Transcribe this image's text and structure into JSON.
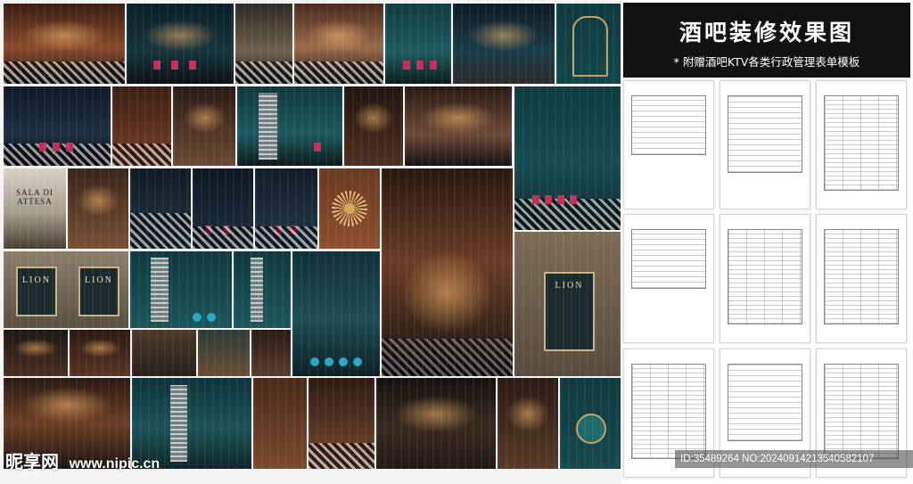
{
  "panel": {
    "title": "酒吧装修效果图",
    "subtitle": "* 附赠酒吧KTV各类行政管理表单模板"
  },
  "collage": {
    "signs": {
      "sala": "SALA DI ATTESA",
      "lion_a": "LION",
      "lion_b": "LION",
      "lion_c": "LION"
    },
    "watermark": {
      "brand": "昵享网",
      "url": "www.nipic.cn"
    }
  },
  "image_id": "ID:35489264 NO:20240914213540582107",
  "colors": {
    "header_bg": "#121212",
    "teal": "#0f4a4f",
    "copper": "#8a4a2c",
    "accent_pink": "#c0305a",
    "accent_cyan": "#2aa5c4"
  }
}
